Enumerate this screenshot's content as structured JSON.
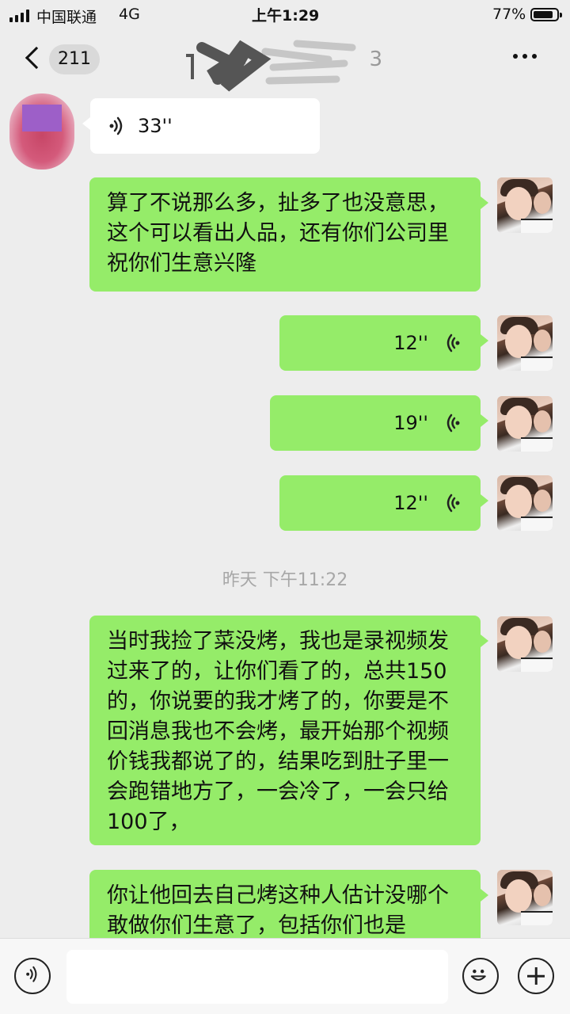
{
  "status_bar": {
    "carrier": "中国联通",
    "network": "4G",
    "time": "上午1:29",
    "battery_percent_label": "77%",
    "battery_level": 0.77
  },
  "nav": {
    "unread_count": "211",
    "title_visible_fragment": "3"
  },
  "messages": [
    {
      "sender": "other",
      "type": "voice",
      "duration": "33''"
    },
    {
      "sender": "me",
      "type": "text",
      "text": "算了不说那么多，扯多了也没意思，这个可以看出人品，还有你们公司里祝你们生意兴隆"
    },
    {
      "sender": "me",
      "type": "voice",
      "duration": "12''"
    },
    {
      "sender": "me",
      "type": "voice",
      "duration": "19''"
    },
    {
      "sender": "me",
      "type": "voice",
      "duration": "12''"
    },
    {
      "type": "timestamp",
      "text": "昨天 下午11:22"
    },
    {
      "sender": "me",
      "type": "text",
      "text": "当时我捡了菜没烤，我也是录视频发过来了的，让你们看了的，总共150的，你说要的我才烤了的，你要是不回消息我也不会烤，最开始那个视频价钱我都说了的，结果吃到肚子里一会跑错地方了，一会冷了，一会只给100了，"
    },
    {
      "sender": "me",
      "type": "text",
      "text": "你让他回去自己烤这种人估计没哪个敢做你们生意了，包括你们也是"
    }
  ],
  "colors": {
    "background": "#ededed",
    "my_bubble": "#95ec69",
    "other_bubble": "#ffffff",
    "timestamp": "#a7a7a7"
  },
  "icons": {
    "back": "back-chevron-icon",
    "more": "more-dots-icon",
    "voice_wave": "voice-wave-icon",
    "voice_toggle": "voice-input-icon",
    "emoji": "emoji-icon",
    "plus": "plus-icon"
  }
}
